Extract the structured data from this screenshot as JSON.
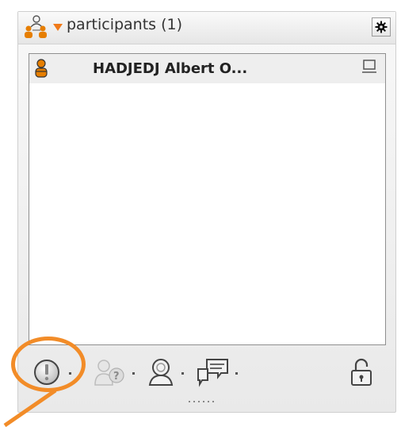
{
  "header": {
    "title": "participants (1)",
    "icons": {
      "people": "people-group-icon",
      "menu_arrow": "triangle-down-icon",
      "options": "gear-icon"
    }
  },
  "participants": [
    {
      "name": "HADJEDJ Albert O...",
      "role_icon": "host-person-icon",
      "status_icon": "monitor-icon"
    }
  ],
  "toolbar": {
    "buttons": [
      {
        "name": "status-button",
        "icon": "exclamation-circle-icon",
        "has_menu": true
      },
      {
        "name": "questions-button",
        "icon": "person-question-icon",
        "has_menu": true
      },
      {
        "name": "role-button",
        "icon": "person-badge-icon",
        "has_menu": true
      },
      {
        "name": "chat-button",
        "icon": "speech-bubbles-icon",
        "has_menu": true
      },
      {
        "name": "lock-button",
        "icon": "unlock-icon",
        "has_menu": false
      }
    ]
  },
  "colors": {
    "accent_orange": "#f28c28",
    "icon_orange": "#e67e00",
    "text": "#222222",
    "panel_border": "#8f8f8f",
    "row_background": "#eeeeee"
  }
}
